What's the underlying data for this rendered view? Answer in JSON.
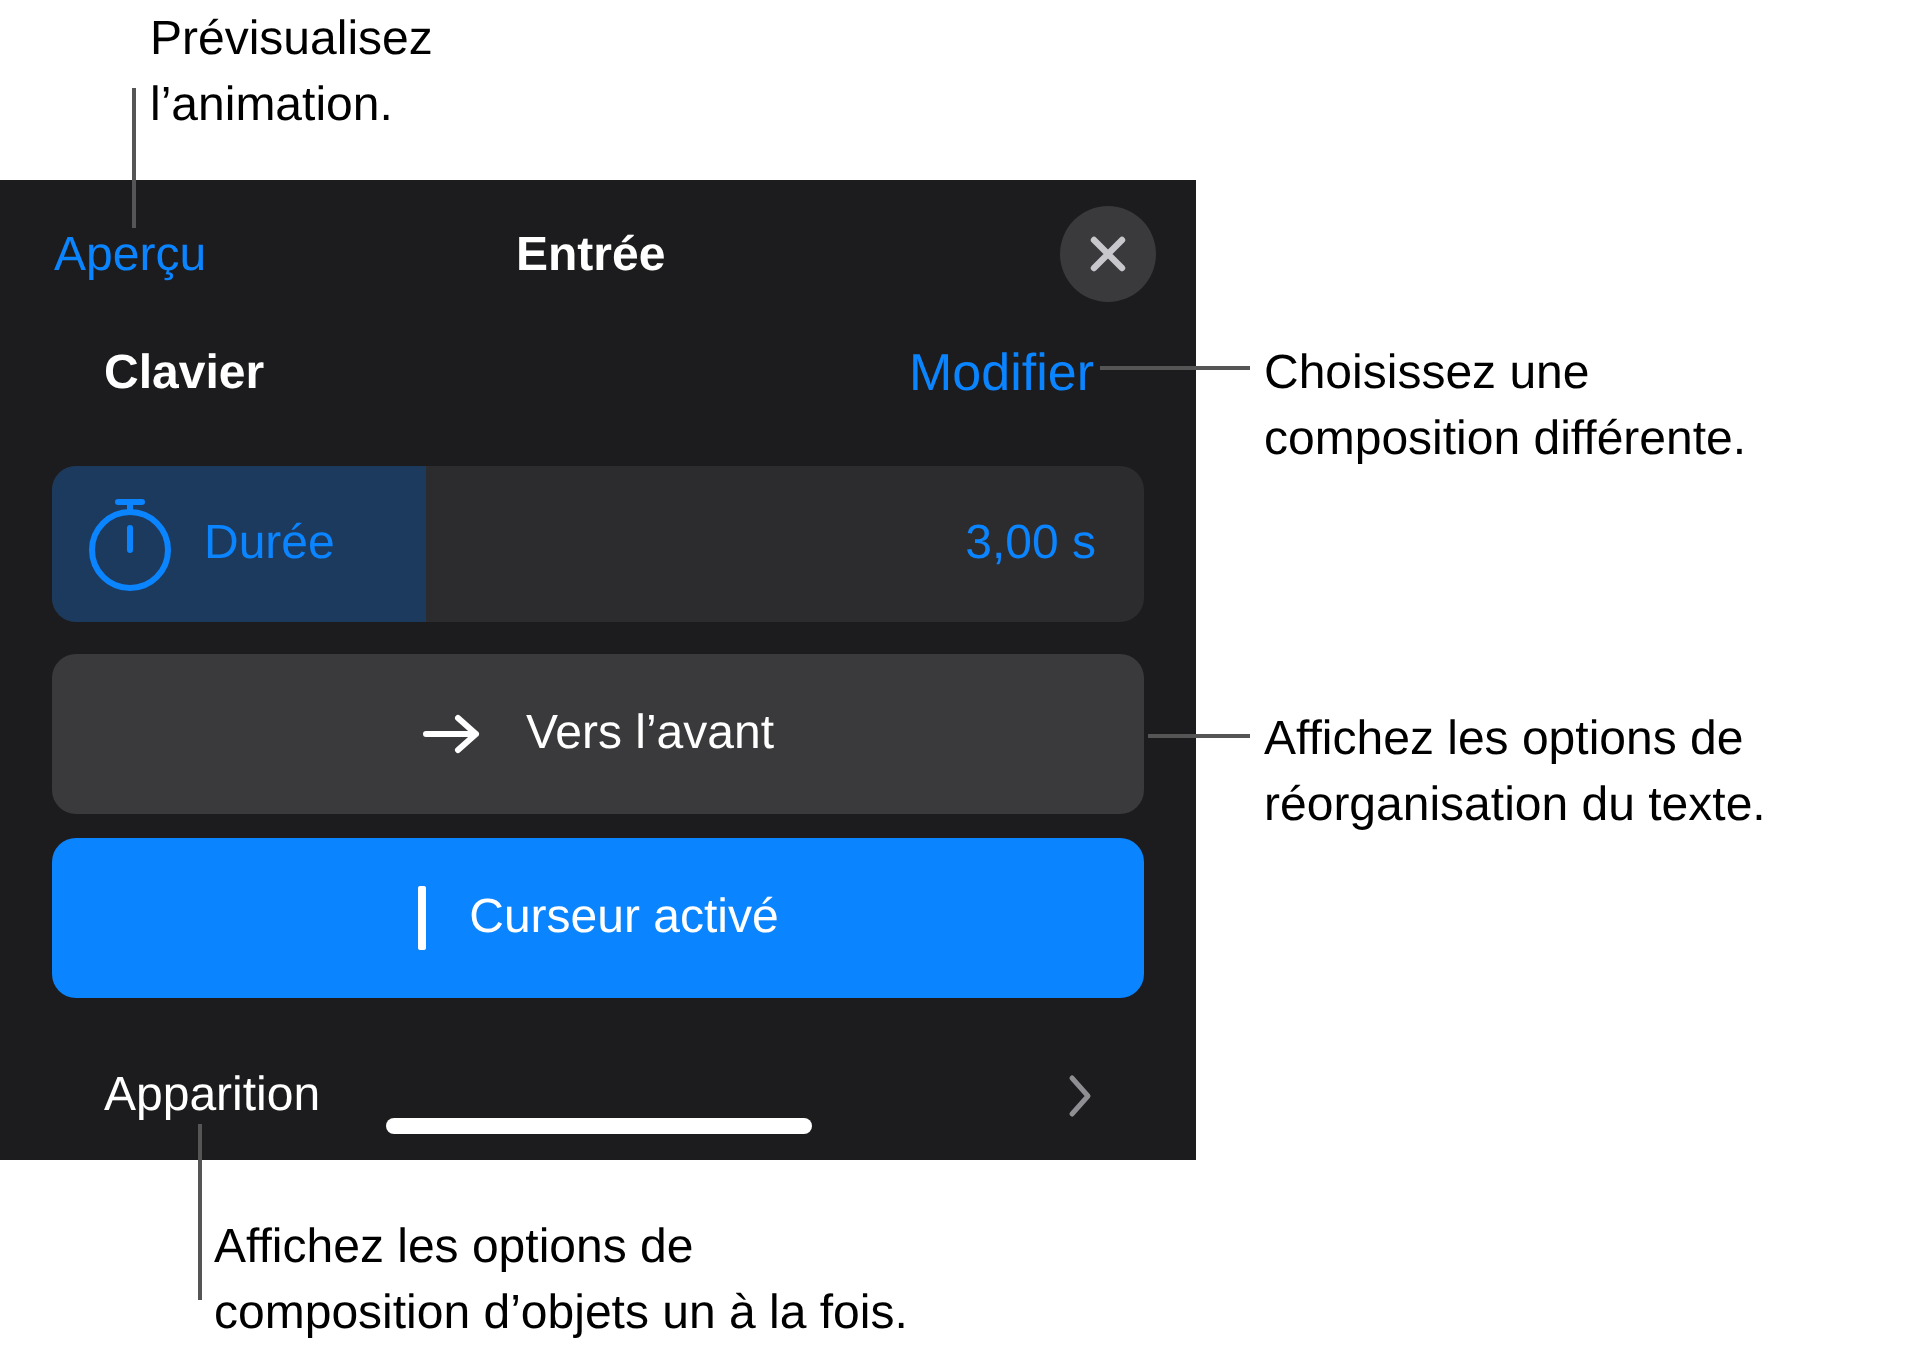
{
  "callouts": [
    {
      "text": "Prévisualisez\nl’animation."
    },
    {
      "text": "Choisissez une\ncomposition différente."
    },
    {
      "text": "Affichez les options de\nréorganisation du texte."
    },
    {
      "text": "Affichez les options de\ncomposition d’objets un à la fois."
    }
  ],
  "panel": {
    "preview_link": "Aperçu",
    "title": "Entrée",
    "build": {
      "label": "Clavier",
      "action": "Modifier"
    },
    "duration": {
      "label": "Durée",
      "value": "3,00 s",
      "selected": true
    },
    "buttons": [
      {
        "kind": "direction",
        "label": "Vers l’avant",
        "on": false
      },
      {
        "kind": "cursor",
        "label": "Curseur activé",
        "on": true
      }
    ],
    "delivery": {
      "label": "Apparition"
    }
  }
}
